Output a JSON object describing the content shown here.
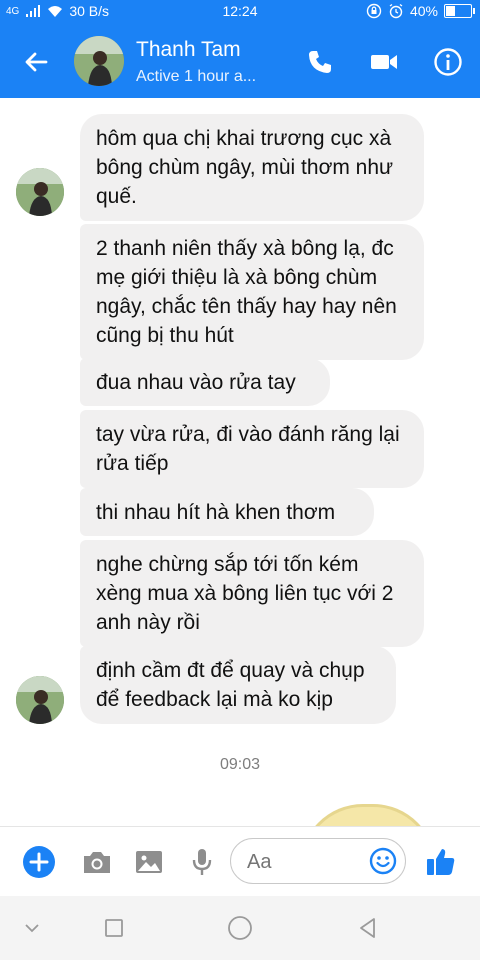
{
  "status_bar": {
    "signal_text": "4G",
    "network_speed": "30 B/s",
    "time": "12:24",
    "battery": "40%",
    "battery_level": 0.4
  },
  "header": {
    "contact_name": "Thanh Tam",
    "activity": "Active 1 hour a...",
    "icons": [
      "back-arrow-icon",
      "phone-icon",
      "video-icon",
      "info-icon"
    ]
  },
  "messages": [
    {
      "text": "hôm qua chị khai trương cục xà bông chùm ngây, mùi thơm như quế.",
      "avatar": true
    },
    {
      "text": "2 thanh niên thấy xà bông lạ, đc mẹ giới thiệu là xà bông chùm ngây, chắc tên thấy hay hay nên cũng bị thu hút",
      "avatar": false
    },
    {
      "text": "đua nhau vào rửa tay",
      "avatar": false
    },
    {
      "text": "tay vừa rửa, đi vào đánh răng lại rửa tiếp",
      "avatar": false
    },
    {
      "text": "thi nhau hít hà khen thơm",
      "avatar": false
    },
    {
      "text": "nghe chừng sắp tới tốn kém xèng mua xà bông liên tục với 2 anh này rồi",
      "avatar": false
    },
    {
      "text": "định cầm đt để quay và chụp để feedback lại mà ko kịp",
      "avatar": true
    }
  ],
  "timestamp": "09:03",
  "composer": {
    "placeholder": "Aa",
    "icons": [
      "plus-icon",
      "camera-icon",
      "image-icon",
      "microphone-icon",
      "emoji-icon",
      "thumbs-up-icon"
    ]
  },
  "colors": {
    "brand_blue": "#1b82f5",
    "bubble_gray": "#f1f0f0"
  }
}
